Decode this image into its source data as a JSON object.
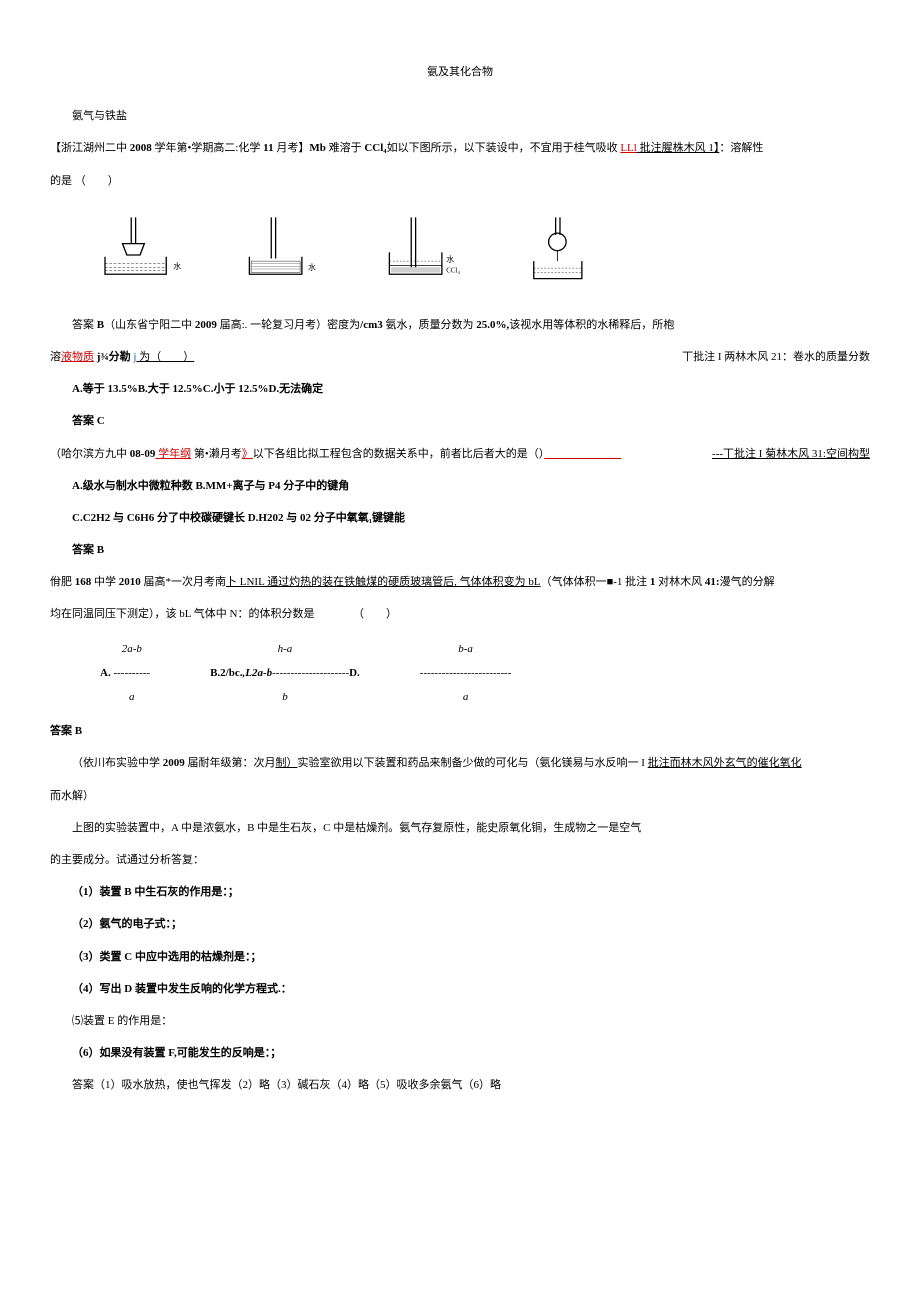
{
  "title": "氨及其化合物",
  "subtitle": "氨气与铁盐",
  "q1": {
    "prefix": "【浙江湖州二中 ",
    "bold1": "2008",
    "mid1": " 学年第•学期高二:化学 ",
    "bold2": "11",
    "mid2": " 月考】",
    "bold3": "Mb",
    "mid3": " 难溶于 ",
    "bold4": "CCl₄",
    "mid4": "如以下图所示，以下装设中，不宜用于桂气吸收 ",
    "link1": "LLl",
    "annot": " 批注腥株木风 1】",
    "mid5": "：溶解性",
    "line2": "的是 （　　）"
  },
  "fig_labels": {
    "water1": "水",
    "water2": "水",
    "water3": "水",
    "ccl4": "CCl₄"
  },
  "q2": {
    "prefix": "答案 ",
    "bold1": "B",
    "text1": "（山东省宁阳二中 ",
    "bold2": "2009",
    "text2": " 届高:. 一轮复习月考）密度为",
    "bold3": "/cm3",
    "text3": " 氨水，质量分数为 ",
    "bold4": "25.0%,",
    "text4": "该视水用等体积的水稀释后，所枹",
    "line2_pre": "溶",
    "line2_link": "液物质",
    "line2_mid": " j¾分勒 ",
    "line2_link2": "j",
    "line2_text": " 为（　　）",
    "line2_annot": "丅批注 I 两林木风 21：卷水的质量分数",
    "options": "A.等于 13.5%B.大于 12.5%C.小于 12.5%D.无法确定",
    "answer": "答案 C"
  },
  "q3": {
    "prefix": "（哈尔滨方九中 ",
    "bold1": "08-09",
    "link1": " 学年纲",
    "text1": " 第•濑月考",
    "link2": "》",
    "text2": "以下各组比拟工程包含的数据关系中，前者比后者大的是（）",
    "annot": "---丅批注 I 菊林木风 31:空间构型",
    "optA": "A.级水与制水中微粒种数 B.MM+离子与 P4 分子中的键角",
    "optC": "C.C2H2 与 C6H6 分了中校碳硬键长 D.H202 与 02 分子中氧氧₁键键能",
    "answer": "答案 B"
  },
  "q4": {
    "text1": "佾肥 ",
    "bold1": "168",
    "text2": " 中学 ",
    "bold2": "2010",
    "text3": " 届高*一次月考南",
    "under1": "卜 LNIL 通过灼热的装在铁触煤的硬质玻璃管后, 气体体积变为 bL",
    "text4": "（气体体积一■-1 批注 ",
    "bold3": "1",
    "text5": " 对林木风 ",
    "bold4": "41:",
    "text6": "漫气的分解",
    "line2": "均在同温同压下测定），该 bL 气体中 N：的体积分数是　　　　（　　）"
  },
  "q4_options": {
    "A_label": "A.",
    "A_top": "2a-b",
    "A_bot": "a",
    "B_label": "B.2/bc.",
    "B_top": "h-a",
    "B_mid": ",L2a-b",
    "B_bot": "b",
    "D_label": "D.",
    "D_top": "b-a",
    "D_bot": "a"
  },
  "q4_answer": "答案 B",
  "q5": {
    "prefix": "（依川布实验中学 ",
    "bold1": "2009",
    "text1": " 届耐年级第：次月",
    "under1": "制）",
    "text2": "实验室欲用以下装置和药品来制备少做的可化与（氨化镁易与水反响一 I ",
    "under2": "批注而林木风外玄气的催化氧化",
    "line2": "而水解）",
    "line3": "上图的实验装置中，A 中是浓氨水，B 中是生石灰，C 中是枯燥剂。氨气存复原性，能史原氧化铜，生成物之一是空气",
    "line4": "的主要成分。试通过分析答复：",
    "item1": "（1）装置 B 中生石灰的作用是：；",
    "item2": "（2）氨气的电子式：；",
    "item3": "（3）类置 C 中应中选用的枯燥剂是：；",
    "item4": "（4）写出 D 装置中发生反响的化学方程式.：",
    "item5": "⑸装置 E 的作用是：",
    "item6": "（6）如果没有装置 F,可能发生的反响是：；",
    "answer": "答案（1）吸水放热，使也气挥发（2）略（3）碱石灰（4）略（5）吸收多余氨气（6）略"
  }
}
